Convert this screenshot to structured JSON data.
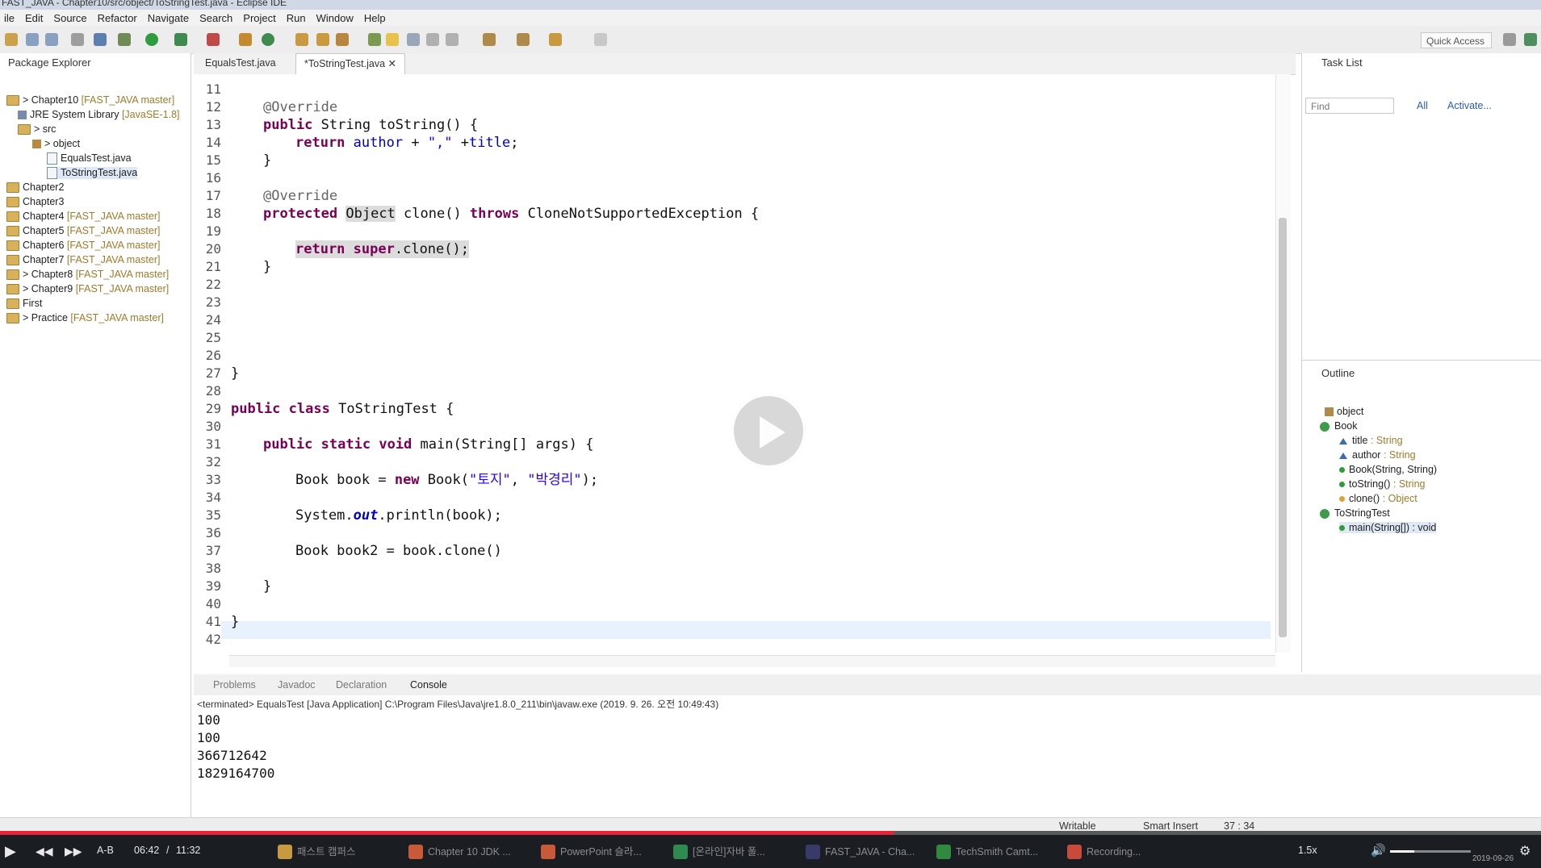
{
  "window": {
    "title": "FAST_JAVA - Chapter10/src/object/ToStringTest.java - Eclipse IDE"
  },
  "menu": [
    "ile",
    "Edit",
    "Source",
    "Refactor",
    "Navigate",
    "Search",
    "Project",
    "Run",
    "Window",
    "Help"
  ],
  "toolbar": {
    "quick_access": "Quick Access"
  },
  "package_explorer": {
    "title": "Package Explorer",
    "items": [
      {
        "label": "> Chapter10",
        "suffix": "[FAST_JAVA master]"
      },
      {
        "label": "JRE System Library",
        "suffix": "[JavaSE-1.8]"
      },
      {
        "label": "> src",
        "suffix": ""
      },
      {
        "label": "> object",
        "suffix": ""
      },
      {
        "label": "EqualsTest.java",
        "suffix": ""
      },
      {
        "label": "ToStringTest.java",
        "suffix": ""
      },
      {
        "label": "Chapter2",
        "suffix": ""
      },
      {
        "label": "Chapter3",
        "suffix": ""
      },
      {
        "label": "Chapter4",
        "suffix": "[FAST_JAVA master]"
      },
      {
        "label": "Chapter5",
        "suffix": "[FAST_JAVA master]"
      },
      {
        "label": "Chapter6",
        "suffix": "[FAST_JAVA master]"
      },
      {
        "label": "Chapter7",
        "suffix": "[FAST_JAVA master]"
      },
      {
        "label": "> Chapter8",
        "suffix": "[FAST_JAVA master]"
      },
      {
        "label": "> Chapter9",
        "suffix": "[FAST_JAVA master]"
      },
      {
        "label": "First",
        "suffix": ""
      },
      {
        "label": "> Practice",
        "suffix": "[FAST_JAVA master]"
      }
    ]
  },
  "editor": {
    "tabs": [
      {
        "label": "EqualsTest.java"
      },
      {
        "label": "*ToStringTest.java"
      }
    ],
    "lines": [
      {
        "n": "11",
        "t": ""
      },
      {
        "n": "12",
        "t": "@Override"
      },
      {
        "n": "13",
        "t": "public String toString() {"
      },
      {
        "n": "14",
        "t": "return author + \",\" +title;"
      },
      {
        "n": "15",
        "t": "}"
      },
      {
        "n": "16",
        "t": ""
      },
      {
        "n": "17",
        "t": "@Override"
      },
      {
        "n": "18",
        "t": "protected Object clone() throws CloneNotSupportedException {"
      },
      {
        "n": "19",
        "t": ""
      },
      {
        "n": "20",
        "t": "return super.clone();"
      },
      {
        "n": "21",
        "t": "}"
      },
      {
        "n": "22",
        "t": ""
      },
      {
        "n": "23",
        "t": ""
      },
      {
        "n": "24",
        "t": ""
      },
      {
        "n": "25",
        "t": ""
      },
      {
        "n": "26",
        "t": ""
      },
      {
        "n": "27",
        "t": "}"
      },
      {
        "n": "28",
        "t": ""
      },
      {
        "n": "29",
        "t": "public class ToStringTest {"
      },
      {
        "n": "30",
        "t": ""
      },
      {
        "n": "31",
        "t": "public static void main(String[] args) {"
      },
      {
        "n": "32",
        "t": ""
      },
      {
        "n": "33",
        "t": "Book book = new Book(\"토지\", \"박경리\");"
      },
      {
        "n": "34",
        "t": ""
      },
      {
        "n": "35",
        "t": "System.out.println(book);"
      },
      {
        "n": "36",
        "t": ""
      },
      {
        "n": "37",
        "t": "Book book2 = book.clone()"
      },
      {
        "n": "38",
        "t": ""
      },
      {
        "n": "39",
        "t": "}"
      },
      {
        "n": "40",
        "t": ""
      },
      {
        "n": "41",
        "t": "}"
      },
      {
        "n": "42",
        "t": ""
      }
    ]
  },
  "tasklist": {
    "title": "Task List",
    "find_placeholder": "Find",
    "all": "All",
    "activate": "Activate..."
  },
  "outline": {
    "title": "Outline",
    "items": [
      {
        "label": "object",
        "type": ""
      },
      {
        "label": "Book",
        "type": ""
      },
      {
        "label": "title",
        "type": ": String"
      },
      {
        "label": "author",
        "type": ": String"
      },
      {
        "label": "Book(String, String)",
        "type": ""
      },
      {
        "label": "toString()",
        "type": ": String"
      },
      {
        "label": "clone()",
        "type": ": Object"
      },
      {
        "label": "ToStringTest",
        "type": ""
      },
      {
        "label": "main(String[]) : void",
        "type": ""
      }
    ]
  },
  "console": {
    "tabs": [
      "Problems",
      "Javadoc",
      "Declaration",
      "Console"
    ],
    "header": "<terminated> EqualsTest [Java Application] C:\\Program Files\\Java\\jre1.8.0_211\\bin\\javaw.exe (2019. 9. 26. 오전 10:49:43)",
    "lines": [
      "100",
      "100",
      "366712642",
      "1829164700"
    ]
  },
  "status": {
    "writable": "Writable",
    "insert_mode": "Smart Insert",
    "position": "37 : 34"
  },
  "player": {
    "time_current": "06:42",
    "time_separator": "/",
    "time_total": "11:32",
    "ab": "A-B",
    "speed": "1.5x",
    "progress": 0.58,
    "date": "2019-09-26",
    "tasks": [
      "패스트 캠퍼스",
      "Chapter 10 JDK ...",
      "PowerPoint 슬라...",
      "[온라인]자바 폴...",
      "FAST_JAVA - Cha...",
      "TechSmith Camt...",
      "Recording..."
    ]
  },
  "colors": {
    "keyword": "#7a0055",
    "string": "#2a00ff",
    "progress": "#e8223a"
  }
}
